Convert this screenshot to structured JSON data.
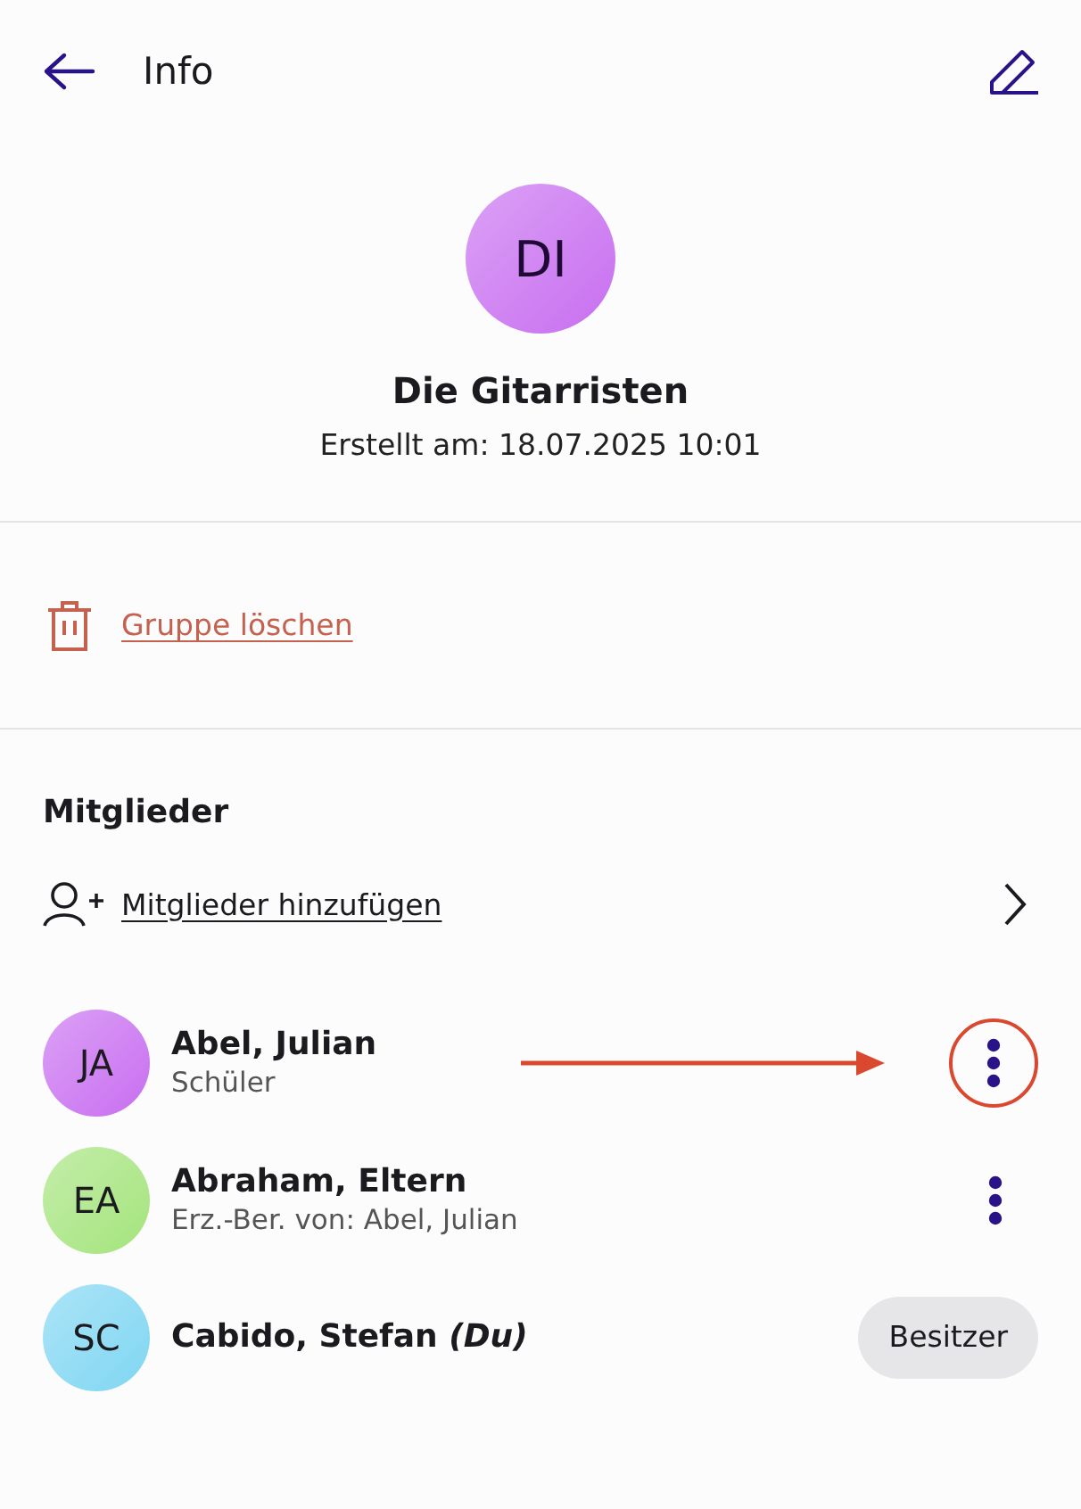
{
  "header": {
    "title": "Info"
  },
  "group": {
    "initials": "DI",
    "color": "#c86ef0",
    "name": "Die Gitarristen",
    "created": "Erstellt am: 18.07.2025 10:01"
  },
  "delete_link": "Gruppe löschen",
  "members_section": {
    "title": "Mitglieder",
    "add_link": "Mitglieder hinzufügen"
  },
  "members": [
    {
      "initials": "JA",
      "color": "#c86ef0",
      "name": "Abel, Julian",
      "role": "Schüler",
      "action": {
        "kind": "menu"
      },
      "highlighted": true
    },
    {
      "initials": "EA",
      "color": "#a4e47c",
      "name": "Abraham, Eltern",
      "role": "Erz.-Ber. von: Abel, Julian",
      "action": {
        "kind": "menu"
      },
      "highlighted": false
    },
    {
      "initials": "SC",
      "color": "#7fd6f2",
      "name": "Cabido, Stefan *(Du)*",
      "action": {
        "kind": "badge",
        "label": "Besitzer"
      },
      "highlighted": false
    }
  ]
}
